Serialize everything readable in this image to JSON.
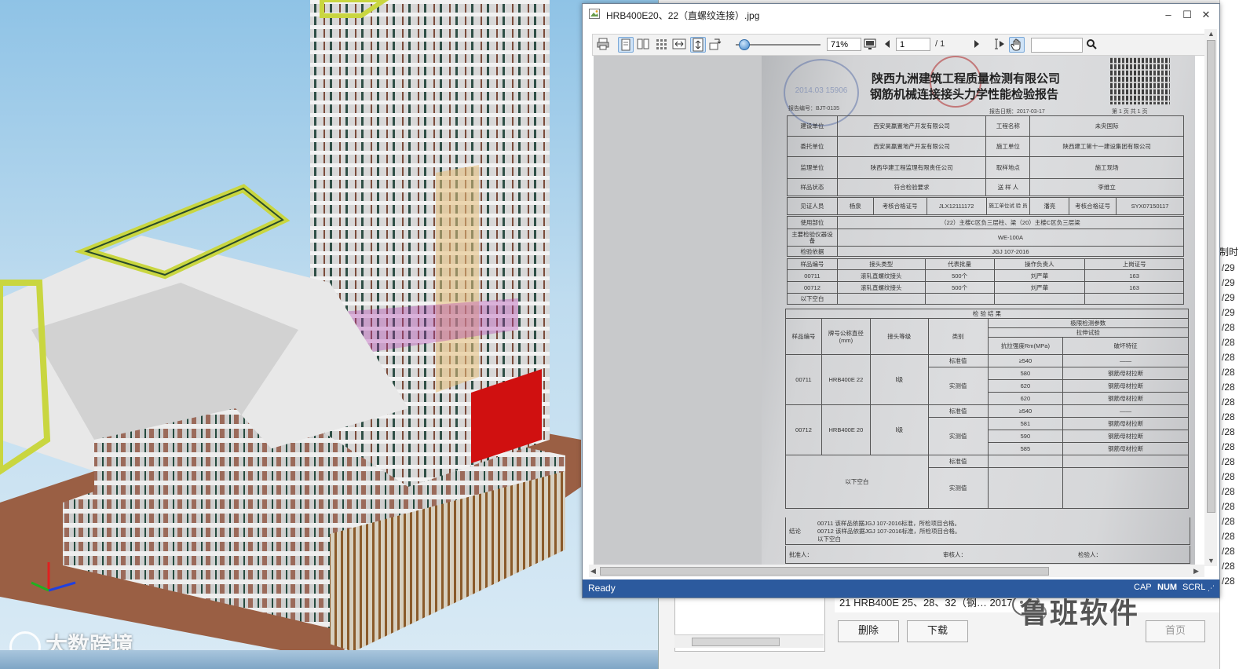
{
  "watermarks": {
    "left": "大数跨境",
    "right": "鲁班软件"
  },
  "viewer": {
    "title": "HRB400E20、22（直螺纹连接）.jpg",
    "zoom": "71%",
    "page_current": "1",
    "page_total": "/ 1",
    "status": "Ready",
    "indicators": [
      "CAP",
      "NUM",
      "SCRL"
    ]
  },
  "report": {
    "org": "陕西九洲建筑工程质量检测有限公司",
    "title": "钢筋机械连接接头力学性能检验报告",
    "report_no_label": "报告编号：",
    "report_no": "BJT-0135",
    "report_date_label": "报告日期：",
    "report_date": "2017-03-17",
    "page_mark": "第 1 页  共 1 页",
    "stamp_text": "2014.03 15906",
    "rows": {
      "build_unit_label": "建设单位",
      "build_unit": "西安昊赢置地产开发有限公司",
      "project_label": "工程名称",
      "project": "未央国际",
      "client_label": "委托单位",
      "client": "西安昊赢置地产开发有限公司",
      "constructor_label": "施工单位",
      "constructor": "陕西建工第十一建设集团有限公司",
      "supervisor_label": "监理单位",
      "supervisor": "陕西华建工程监理有限责任公司",
      "sampling_label": "取样地点",
      "sampling": "施工现场",
      "sample_state_label": "样品状态",
      "sample_state": "符合检验要求",
      "sender_label": "送 样 人",
      "sender": "李维立",
      "witness_label": "见证人员",
      "witness": "杨泉",
      "cert_label": "考核合格证号",
      "cert": "JLX12111172",
      "inspector_label": "施工单位试 验 员",
      "inspector": "潘亮",
      "cert2_label": "考核合格证号",
      "cert2": "SYX07150117",
      "usage_label": "使用部位",
      "usage": "（22）主楼C区负三层柱、梁（20）主楼C区负三层梁",
      "equipment_label": "主要检验仪器设备",
      "equipment": "WE-100A",
      "basis_label": "检验依据",
      "basis": "JGJ 107-2016"
    },
    "samples_header": [
      "样品编号",
      "接头类型",
      "代表批量",
      "操作负责人",
      "上岗证号"
    ],
    "samples": [
      [
        "00711",
        "滚轧直螺纹接头",
        "500个",
        "刘严華",
        "163"
      ],
      [
        "00712",
        "滚轧直螺纹接头",
        "500个",
        "刘严華",
        "163"
      ]
    ],
    "samples_blank": "以下空白",
    "result_header": "检    验    结    果",
    "res_col": {
      "sample_no": "样品编号",
      "spec": "牌号公称直径(mm)",
      "grade": "接头等级",
      "category": "类别",
      "params": "极限检测参数",
      "tensile": "拉伸试验",
      "strength": "抗拉强度Rm(MPa)",
      "failure": "破坏特征"
    },
    "results": [
      {
        "no": "00711",
        "spec": "HRB400E 22",
        "grade": "Ⅰ级",
        "std_label": "标准值",
        "std_val": "≥540",
        "std_fail": "——",
        "act_label": "实测值",
        "act": [
          [
            "580",
            "钢筋母材拉断"
          ],
          [
            "620",
            "钢筋母材拉断"
          ],
          [
            "620",
            "钢筋母材拉断"
          ]
        ]
      },
      {
        "no": "00712",
        "spec": "HRB400E 20",
        "grade": "Ⅰ级",
        "std_label": "标准值",
        "std_val": "≥540",
        "std_fail": "——",
        "act_label": "实测值",
        "act": [
          [
            "581",
            "钢筋母材拉断"
          ],
          [
            "590",
            "钢筋母材拉断"
          ],
          [
            "585",
            "钢筋母材拉断"
          ]
        ]
      }
    ],
    "blank_label": "以下空白",
    "blank_std": "标准值",
    "blank_act": "实测值",
    "conclusion_label": "结论",
    "conclusion": [
      "00711  该样品依据JGJ 107-2016标准，所检项目合格。",
      "00712  该样品依据JGJ 107-2016标准，所检项目合格。",
      "以下空白"
    ],
    "signs": [
      "批准人：",
      "审核人：",
      "检验人："
    ]
  },
  "background_app": {
    "list_row": "21   HRB400E 25、28、32（钢…    2017/4/27",
    "btn_delete": "删除",
    "btn_download": "下载",
    "btn_home": "首页",
    "edge_label": "制时",
    "edge_dates": [
      "/29",
      "/29",
      "/29",
      "/29",
      "/28",
      "/28",
      "/28",
      "/28",
      "/28",
      "/28",
      "/28",
      "/28",
      "/28",
      "/28",
      "/28",
      "/28",
      "/28",
      "/28",
      "/28",
      "/28",
      "/28",
      "/28"
    ]
  },
  "colors": {
    "status_bar": "#2c5a9e",
    "accent": "#3b82c8"
  }
}
